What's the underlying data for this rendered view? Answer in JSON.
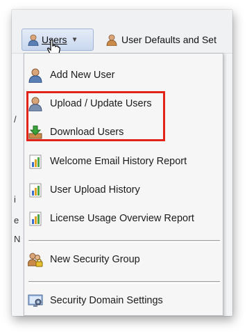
{
  "toolbar": {
    "users_label": "Users",
    "defaults_label": "User Defaults and Set"
  },
  "menu": {
    "items": [
      {
        "label": "Add New User",
        "icon": "user-icon"
      },
      {
        "label": "Upload / Update Users",
        "icon": "user-icon"
      },
      {
        "label": "Download Users",
        "icon": "download-tray-icon"
      },
      {
        "label": "Welcome Email History Report",
        "icon": "report-chart-icon"
      },
      {
        "label": "User Upload History",
        "icon": "report-chart-icon"
      },
      {
        "label": "License Usage Overview Report",
        "icon": "report-chart-icon"
      },
      {
        "label": "New Security Group",
        "icon": "group-lock-icon"
      },
      {
        "label": "Security Domain Settings",
        "icon": "domain-settings-icon"
      }
    ]
  },
  "colors": {
    "highlight": "#e2231a",
    "menu_bg": "#f6f6f7",
    "button_bg": "#c9d7ee"
  }
}
